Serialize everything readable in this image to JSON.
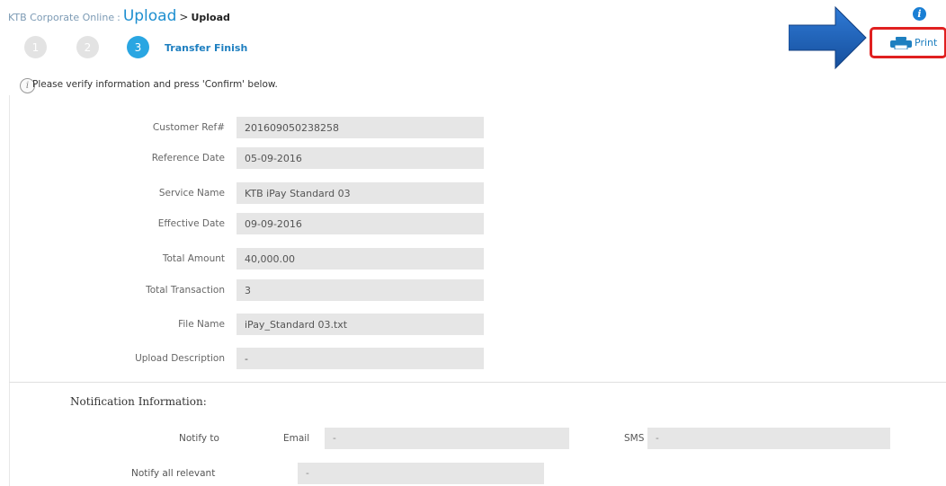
{
  "breadcrumb": {
    "app": "KTB Corporate Online",
    "separator": ":",
    "link": "Upload",
    "arrow": ">",
    "current": "Upload"
  },
  "steps": [
    {
      "number": "1",
      "active": false
    },
    {
      "number": "2",
      "active": false
    },
    {
      "number": "3",
      "active": true,
      "label": "Transfer Finish"
    }
  ],
  "info": {
    "icon": "i",
    "text": "Please verify information and press 'Confirm' below."
  },
  "help": {
    "icon": "i"
  },
  "print": {
    "label": "Print"
  },
  "fields": [
    {
      "label": "Customer Ref#",
      "value": "201609050238258"
    },
    {
      "label": "Reference Date",
      "value": "05-09-2016"
    },
    {
      "label": "Service Name",
      "value": "KTB iPay Standard 03"
    },
    {
      "label": "Effective Date",
      "value": "09-09-2016"
    },
    {
      "label": "Total Amount",
      "value": "40,000.00"
    },
    {
      "label": "Total Transaction",
      "value": "3"
    },
    {
      "label": "File Name",
      "value": "iPay_Standard 03.txt"
    },
    {
      "label": "Upload Description",
      "value": "-"
    }
  ],
  "notification": {
    "title": "Notification Information:",
    "notify_to": "Notify to",
    "email_label": "Email",
    "email_value": "-",
    "sms_label": "SMS",
    "sms_value": "-",
    "notify_all": "Notify all relevant",
    "notify_all_value": "-"
  },
  "colors": {
    "accent": "#1e8fd0",
    "step_active": "#2aa6e2",
    "arrow": "#1c5fb8",
    "highlight_border": "#e02020",
    "field_bg": "#e6e6e6"
  }
}
